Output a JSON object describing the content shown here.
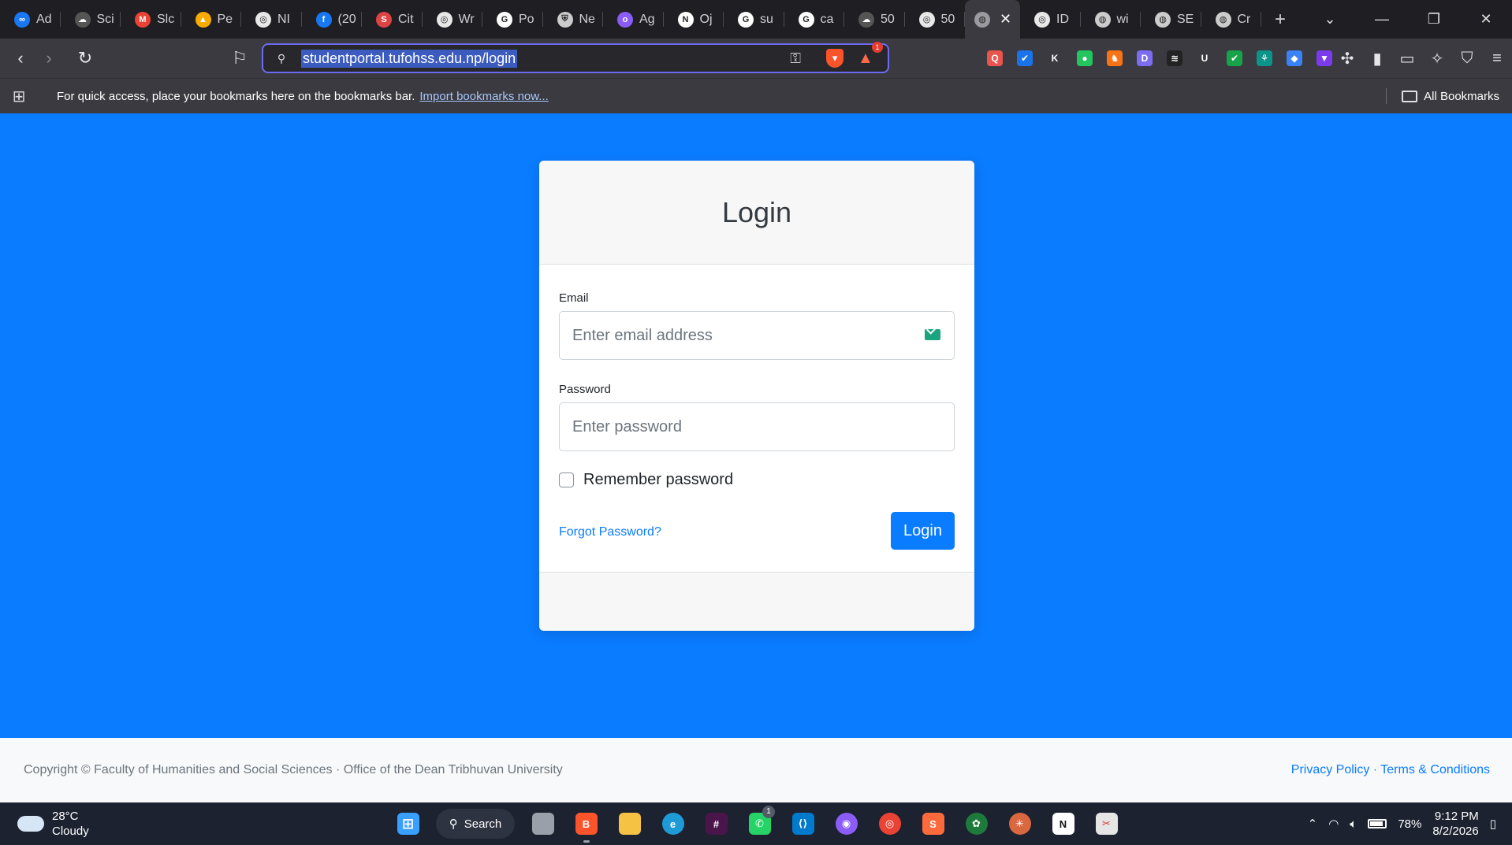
{
  "browser": {
    "tabs": [
      {
        "label": "Ad",
        "icon": "meta-icon",
        "color": "#1877f2",
        "glyph": "∞"
      },
      {
        "label": "Sci",
        "icon": "cloud-icon",
        "color": "#555",
        "glyph": "☁"
      },
      {
        "label": "Slc",
        "icon": "gmail-icon",
        "color": "#ea4335",
        "glyph": "M"
      },
      {
        "label": "Pe",
        "icon": "analytics-icon",
        "color": "#f9ab00",
        "glyph": "▲"
      },
      {
        "label": "NI",
        "icon": "openai-icon",
        "color": "#e8e8e8",
        "glyph": "◎"
      },
      {
        "label": "(20",
        "icon": "facebook-icon",
        "color": "#1877f2",
        "glyph": "f"
      },
      {
        "label": "Cit",
        "icon": "scholar-icon",
        "color": "#d44",
        "glyph": "S"
      },
      {
        "label": "Wr",
        "icon": "openai-icon",
        "color": "#e8e8e8",
        "glyph": "◎"
      },
      {
        "label": "Po",
        "icon": "google-icon",
        "color": "#fff",
        "glyph": "G"
      },
      {
        "label": "Ne",
        "icon": "shield-icon",
        "color": "#ccc",
        "glyph": "⛨"
      },
      {
        "label": "Ag",
        "icon": "agent-icon",
        "color": "#8a5cf6",
        "glyph": "o"
      },
      {
        "label": "Oj",
        "icon": "notion-icon",
        "color": "#fff",
        "glyph": "N"
      },
      {
        "label": "su",
        "icon": "google-icon",
        "color": "#fff",
        "glyph": "G"
      },
      {
        "label": "ca",
        "icon": "google-icon",
        "color": "#fff",
        "glyph": "G"
      },
      {
        "label": "50",
        "icon": "cloud-icon",
        "color": "#555",
        "glyph": "☁"
      },
      {
        "label": "50",
        "icon": "openai-icon",
        "color": "#e8e8e8",
        "glyph": "◎"
      }
    ],
    "tabs_after": [
      {
        "label": "ID",
        "icon": "openai-icon",
        "color": "#e8e8e8",
        "glyph": "◎"
      },
      {
        "label": "wi",
        "icon": "globe-icon",
        "color": "#ccc",
        "glyph": "◍"
      },
      {
        "label": "SE",
        "icon": "globe-icon",
        "color": "#ccc",
        "glyph": "◍"
      },
      {
        "label": "Cr",
        "icon": "globe-icon",
        "color": "#ccc",
        "glyph": "◍"
      }
    ],
    "active_tab_close": "✕",
    "new_tab": "+",
    "url": "studentportal.tufohss.edu.np/login",
    "rewards_count": "1",
    "bookmarks_hint": "For quick access, place your bookmarks here on the bookmarks bar.",
    "import_link": "Import bookmarks now...",
    "all_bookmarks": "All Bookmarks"
  },
  "extensions": [
    {
      "name": "ext-1",
      "color": "#e8554e",
      "glyph": "Q"
    },
    {
      "name": "ext-2",
      "color": "#1a73e8",
      "glyph": "✔"
    },
    {
      "name": "ext-3",
      "color": "#3a3a40",
      "glyph": "K"
    },
    {
      "name": "ext-4",
      "color": "#22c55e",
      "glyph": "●"
    },
    {
      "name": "ext-5",
      "color": "#f97316",
      "glyph": "♞"
    },
    {
      "name": "ext-6",
      "color": "#7c6cf0",
      "glyph": "D"
    },
    {
      "name": "ext-7",
      "color": "#222",
      "glyph": "≋"
    },
    {
      "name": "ext-8",
      "color": "#3a3a40",
      "glyph": "U"
    },
    {
      "name": "ext-9",
      "color": "#16a34a",
      "glyph": "✔"
    },
    {
      "name": "ext-10",
      "color": "#0d9488",
      "glyph": "⚘"
    },
    {
      "name": "ext-11",
      "color": "#3b82f6",
      "glyph": "◆"
    },
    {
      "name": "ext-12",
      "color": "#7c3aed",
      "glyph": "▼"
    }
  ],
  "login": {
    "title": "Login",
    "email_label": "Email",
    "email_placeholder": "Enter email address",
    "password_label": "Password",
    "password_placeholder": "Enter password",
    "remember_label": "Remember password",
    "forgot_link": "Forgot Password?",
    "submit_label": "Login"
  },
  "footer": {
    "copyright": "Copyright © Faculty of Humanities and Social Sciences · Office of the Dean Tribhuvan University",
    "privacy": "Privacy Policy",
    "separator": "·",
    "terms": "Terms & Conditions"
  },
  "taskbar": {
    "temperature": "28°C",
    "condition": "Cloudy",
    "search_label": "Search",
    "whatsapp_badge": "1",
    "battery": "78%",
    "time": "9:12 PM",
    "date": "8/2/2026"
  },
  "colors": {
    "page_background": "#0a7cff",
    "primary": "#0a7cff",
    "chrome_dark": "#1f1f23",
    "toolbar": "#3a3a40"
  }
}
